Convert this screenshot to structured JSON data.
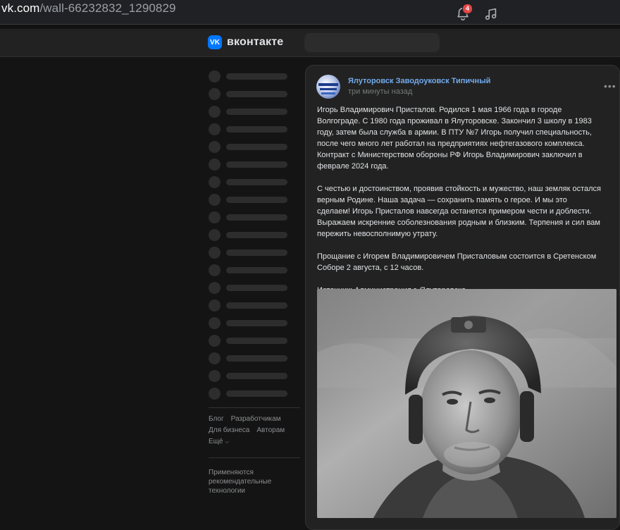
{
  "browser": {
    "url_host": "vk.com",
    "url_path": "/wall-66232832_1290829"
  },
  "header": {
    "logo_text": "вконтакте",
    "logo_icon": "vk-logo-icon",
    "notifications_count": "4",
    "brand_color": "#0077ff",
    "accent_color": "#71aaeb"
  },
  "sidebar": {
    "skeleton_items": 19,
    "footer_links": [
      "Блог",
      "Разработчикам",
      "Для бизнеса",
      "Авторам",
      "Ещё"
    ],
    "recommendation_note": "Применяются рекомендательные технологии"
  },
  "post": {
    "author": "Ялуторовск Заводоуковск Типичный",
    "time": "три минуты назад",
    "paragraphs": [
      "Игорь Владимирович Присталов. Родился 1 мая 1966 года в городе Волгограде. С 1980 года проживал в Ялуторовске. Закончил 3 школу в 1983 году, затем была служба в армии. В ПТУ №7 Игорь получил специальность, после чего много лет работал на предприятиях нефтегазового комплекса. Контракт с Министерством обороны РФ Игорь Владимирович заключил в феврале 2024 года.",
      "С честью и достоинством, проявив стойкость и мужество, наш земляк остался верным Родине. Наша задача — сохранить память о герое. И мы это сделаем! Игорь Присталов навсегда останется примером чести и доблести. Выражаем искренние соболезнования родным и близким. Терпения и сил вам пережить невосполнимую утрату.",
      "Прощание с Игорем Владимировичем Присталовым состоится в Сретенском Соборе 2 августа, с 12 часов.",
      "Источник: Администрация г. Ялуторовска"
    ]
  }
}
